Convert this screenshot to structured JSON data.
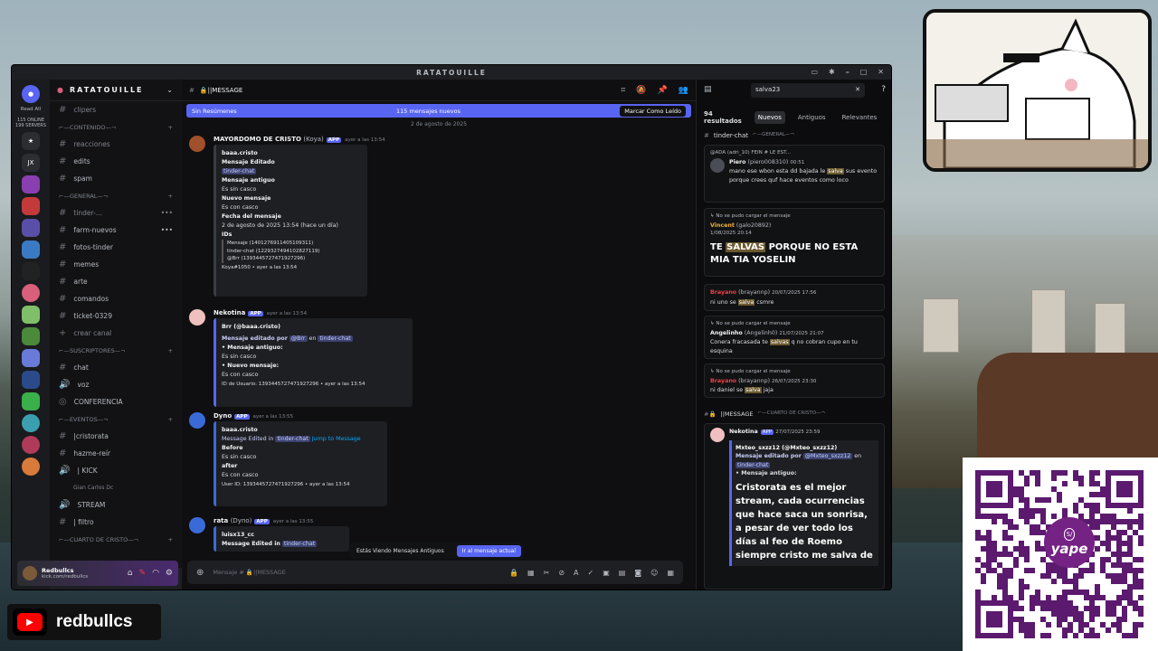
{
  "window": {
    "title": "RATATOUILLE"
  },
  "servers": {
    "read_all": "Read All",
    "online": "115 ONLINE",
    "servers": "199 SERVERS",
    "jx": "JX"
  },
  "channels": {
    "server_name": "RATATOUILLE",
    "items": [
      {
        "name": "clipers"
      },
      {
        "cat": "CONTENIDO"
      },
      {
        "name": "reacciones"
      },
      {
        "name": "edits"
      },
      {
        "name": "spam"
      },
      {
        "cat": "GENERAL"
      },
      {
        "name": "tinder-..."
      },
      {
        "name": "farm-nuevos"
      },
      {
        "name": "fotos-tinder"
      },
      {
        "name": "memes"
      },
      {
        "name": "arte"
      },
      {
        "name": "comandos"
      },
      {
        "name": "ticket-0329"
      },
      {
        "name": "crear canal"
      },
      {
        "cat": "SUSCRIPTORES"
      },
      {
        "name": "chat"
      },
      {
        "name": "voz"
      },
      {
        "name": "CONFERENCIA"
      },
      {
        "cat": "EVENTOS"
      },
      {
        "name": "|cristorata"
      },
      {
        "name": "hazme-reír"
      },
      {
        "name": "| KICK"
      },
      {
        "name": "Gian Carlos Dc"
      },
      {
        "name": "STREAM"
      },
      {
        "name": "| filtro"
      },
      {
        "cat": "CUARTO DE CRISTO"
      }
    ],
    "user": {
      "name": "Redbullcs",
      "status": "kick.com/redbullcs"
    }
  },
  "main": {
    "channel": "||MESSAGE",
    "banner": {
      "left": "Sin Resúmenes",
      "center": "115 mensajes nuevos",
      "right": "Marcar Como Leído"
    },
    "date_divider": "2 de agosto de 2025",
    "messages": [
      {
        "author": "MAYORDOMO DE CRISTO",
        "sub": "(Koya)",
        "tag": "APP",
        "time": "ayer a las 13:54",
        "lines": [
          "baaa.cristo",
          "Mensaje Editado",
          "tinder-chat",
          "Mensaje antiguo",
          "Es sin casco",
          "Nuevo mensaje",
          "Es con casco",
          "Fecha del mensaje",
          "2 de agosto de 2025 13:54 (hace un día)",
          "IDs",
          "Mensaje (1401276911405109311)",
          "tinder-chat (1229327494102827119)",
          "@Brr (1393445727471927296)",
          "Koya#1050 • ayer a las 13:54"
        ]
      },
      {
        "author": "Nekotina",
        "tag": "APP",
        "time": "ayer a las 13:54",
        "lines": [
          "Brr (@baaa.cristo)",
          "Mensaje editado por",
          "@Brr",
          "en",
          "tinder-chat",
          "Mensaje antiguo:",
          "Es sin casco",
          "Nuevo mensaje:",
          "Es con casco",
          "ID de Usuario: 1393445727471927296 • ayer a las 13:54"
        ]
      },
      {
        "author": "Dyno",
        "tag": "APP",
        "time": "ayer a las 13:55",
        "lines": [
          "baaa.cristo",
          "Message Edited in",
          "tinder-chat",
          "Jump to Message",
          "Before",
          "Es sin casco",
          "after",
          "Es con casco",
          "User ID: 1393445727471927296 • ayer a las 13:54"
        ]
      },
      {
        "author": "rata",
        "sub": "(Dyno)",
        "tag": "APP",
        "time": "ayer a las 13:55",
        "lines": [
          "luisx13_cc",
          "Message Edited in",
          "tinder-chat"
        ]
      }
    ],
    "jump_bar": {
      "text": "Estás Viendo Mensajes Antiguos",
      "button": "Ir al mensaje actual"
    },
    "composer": {
      "placeholder": "Mensaje # 🔒||MESSAGE"
    }
  },
  "search": {
    "query": "salva23",
    "count": "94 resultados",
    "tabs": [
      "Nuevos",
      "Antiguos",
      "Relevantes"
    ],
    "group1": "tinder-chat",
    "group1_cat": "GENERAL",
    "results": [
      {
        "ref": "@ADA (adri_10) FEIN # LE EST...",
        "author": "Piero",
        "handle": "(piero008310)",
        "time": "00:51",
        "pre": "mano ese wbon esta dd bajada le ",
        "hit": "salva",
        "post": " sus evento porque crees quf hace eventos como loco"
      },
      {
        "ref": "No se pudo cargar el mensaje",
        "author": "Vincent",
        "handle": "(galo20892)",
        "time": "1/08/2025 20:14",
        "pre": "TE ",
        "hit": "SALVAS",
        "post": " PORQUE NO ESTA MIA TIA YOSELIN"
      },
      {
        "author": "Brayano",
        "handle": "(brayannp)",
        "time": "20/07/2025 17:56",
        "pre": "ni uno se ",
        "hit": "salva",
        "post": " csmre"
      },
      {
        "ref": "No se pudo cargar el mensaje",
        "author": "Angelinho",
        "handle": "(Angelinh0)",
        "time": "21/07/2025 21:07",
        "pre": "Conera fracasada te ",
        "hit": "salvas",
        "post": " q no cobran cupo en tu esquina"
      },
      {
        "ref": "No se pudo cargar el mensaje",
        "author": "Brayano",
        "handle": "(brayannp)",
        "time": "26/07/2025 23:30",
        "pre": "ni daniel se ",
        "hit": "salva",
        "post": " jaja"
      }
    ],
    "group2": "||MESSAGE",
    "group2_cat": "CUARTO DE CRISTO",
    "nekotina": {
      "author": "Nekotina",
      "tag": "APP",
      "time": "27/07/2025 23:59",
      "embed_user": "Mxteo_sxzz12 (@Mxteo_sxzz12)",
      "edited": "Mensaje editado por",
      "mention": "@Mxteo_sxzz12",
      "en": "en",
      "channel": "tinder-chat",
      "old": "Mensaje antiguo:",
      "big": "Cristorata es el mejor stream, cada ocurrencias que hace saca un sonrisa, a pesar de ver todo los días al feo de Roemo siempre cristo me salva de"
    }
  },
  "overlay": {
    "youtube": "redbullcs",
    "qr_brand": "yape",
    "qr_badge": "S/"
  }
}
